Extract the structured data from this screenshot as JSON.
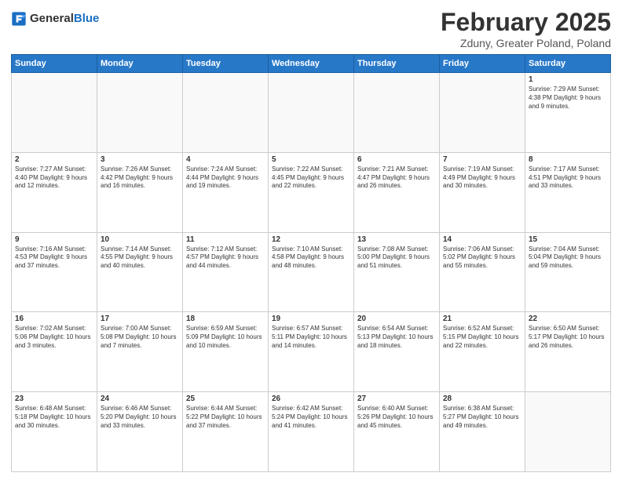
{
  "header": {
    "logo": {
      "line1": "General",
      "line2": "Blue",
      "icon_alt": "GeneralBlue logo"
    },
    "title": "February 2025",
    "subtitle": "Zduny, Greater Poland, Poland"
  },
  "weekdays": [
    "Sunday",
    "Monday",
    "Tuesday",
    "Wednesday",
    "Thursday",
    "Friday",
    "Saturday"
  ],
  "weeks": [
    [
      {
        "day": "",
        "info": ""
      },
      {
        "day": "",
        "info": ""
      },
      {
        "day": "",
        "info": ""
      },
      {
        "day": "",
        "info": ""
      },
      {
        "day": "",
        "info": ""
      },
      {
        "day": "",
        "info": ""
      },
      {
        "day": "1",
        "info": "Sunrise: 7:29 AM\nSunset: 4:38 PM\nDaylight: 9 hours\nand 9 minutes."
      }
    ],
    [
      {
        "day": "2",
        "info": "Sunrise: 7:27 AM\nSunset: 4:40 PM\nDaylight: 9 hours\nand 12 minutes."
      },
      {
        "day": "3",
        "info": "Sunrise: 7:26 AM\nSunset: 4:42 PM\nDaylight: 9 hours\nand 16 minutes."
      },
      {
        "day": "4",
        "info": "Sunrise: 7:24 AM\nSunset: 4:44 PM\nDaylight: 9 hours\nand 19 minutes."
      },
      {
        "day": "5",
        "info": "Sunrise: 7:22 AM\nSunset: 4:45 PM\nDaylight: 9 hours\nand 22 minutes."
      },
      {
        "day": "6",
        "info": "Sunrise: 7:21 AM\nSunset: 4:47 PM\nDaylight: 9 hours\nand 26 minutes."
      },
      {
        "day": "7",
        "info": "Sunrise: 7:19 AM\nSunset: 4:49 PM\nDaylight: 9 hours\nand 30 minutes."
      },
      {
        "day": "8",
        "info": "Sunrise: 7:17 AM\nSunset: 4:51 PM\nDaylight: 9 hours\nand 33 minutes."
      }
    ],
    [
      {
        "day": "9",
        "info": "Sunrise: 7:16 AM\nSunset: 4:53 PM\nDaylight: 9 hours\nand 37 minutes."
      },
      {
        "day": "10",
        "info": "Sunrise: 7:14 AM\nSunset: 4:55 PM\nDaylight: 9 hours\nand 40 minutes."
      },
      {
        "day": "11",
        "info": "Sunrise: 7:12 AM\nSunset: 4:57 PM\nDaylight: 9 hours\nand 44 minutes."
      },
      {
        "day": "12",
        "info": "Sunrise: 7:10 AM\nSunset: 4:58 PM\nDaylight: 9 hours\nand 48 minutes."
      },
      {
        "day": "13",
        "info": "Sunrise: 7:08 AM\nSunset: 5:00 PM\nDaylight: 9 hours\nand 51 minutes."
      },
      {
        "day": "14",
        "info": "Sunrise: 7:06 AM\nSunset: 5:02 PM\nDaylight: 9 hours\nand 55 minutes."
      },
      {
        "day": "15",
        "info": "Sunrise: 7:04 AM\nSunset: 5:04 PM\nDaylight: 9 hours\nand 59 minutes."
      }
    ],
    [
      {
        "day": "16",
        "info": "Sunrise: 7:02 AM\nSunset: 5:06 PM\nDaylight: 10 hours\nand 3 minutes."
      },
      {
        "day": "17",
        "info": "Sunrise: 7:00 AM\nSunset: 5:08 PM\nDaylight: 10 hours\nand 7 minutes."
      },
      {
        "day": "18",
        "info": "Sunrise: 6:59 AM\nSunset: 5:09 PM\nDaylight: 10 hours\nand 10 minutes."
      },
      {
        "day": "19",
        "info": "Sunrise: 6:57 AM\nSunset: 5:11 PM\nDaylight: 10 hours\nand 14 minutes."
      },
      {
        "day": "20",
        "info": "Sunrise: 6:54 AM\nSunset: 5:13 PM\nDaylight: 10 hours\nand 18 minutes."
      },
      {
        "day": "21",
        "info": "Sunrise: 6:52 AM\nSunset: 5:15 PM\nDaylight: 10 hours\nand 22 minutes."
      },
      {
        "day": "22",
        "info": "Sunrise: 6:50 AM\nSunset: 5:17 PM\nDaylight: 10 hours\nand 26 minutes."
      }
    ],
    [
      {
        "day": "23",
        "info": "Sunrise: 6:48 AM\nSunset: 5:18 PM\nDaylight: 10 hours\nand 30 minutes."
      },
      {
        "day": "24",
        "info": "Sunrise: 6:46 AM\nSunset: 5:20 PM\nDaylight: 10 hours\nand 33 minutes."
      },
      {
        "day": "25",
        "info": "Sunrise: 6:44 AM\nSunset: 5:22 PM\nDaylight: 10 hours\nand 37 minutes."
      },
      {
        "day": "26",
        "info": "Sunrise: 6:42 AM\nSunset: 5:24 PM\nDaylight: 10 hours\nand 41 minutes."
      },
      {
        "day": "27",
        "info": "Sunrise: 6:40 AM\nSunset: 5:26 PM\nDaylight: 10 hours\nand 45 minutes."
      },
      {
        "day": "28",
        "info": "Sunrise: 6:38 AM\nSunset: 5:27 PM\nDaylight: 10 hours\nand 49 minutes."
      },
      {
        "day": "",
        "info": ""
      }
    ]
  ]
}
